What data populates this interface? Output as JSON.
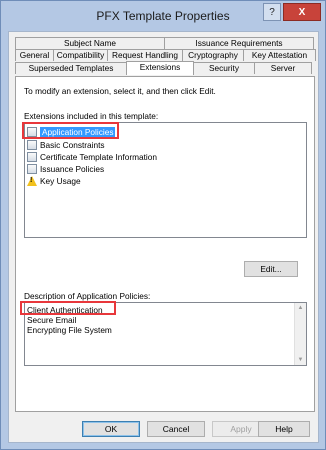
{
  "window": {
    "title": "PFX Template Properties",
    "help_button": "?",
    "close_button": "X"
  },
  "tabs": {
    "row1": [
      "Subject Name",
      "Issuance Requirements"
    ],
    "row2": [
      "General",
      "Compatibility",
      "Request Handling",
      "Cryptography",
      "Key Attestation"
    ],
    "row3": [
      "Superseded Templates",
      "Extensions",
      "Security",
      "Server"
    ],
    "active": "Extensions"
  },
  "extensions": {
    "instruction": "To modify an extension, select it, and then click Edit.",
    "list_label": "Extensions included in this template:",
    "items": [
      {
        "label": "Application Policies",
        "icon": "extension-icon",
        "selected": true
      },
      {
        "label": "Basic Constraints",
        "icon": "extension-icon",
        "selected": false
      },
      {
        "label": "Certificate Template Information",
        "icon": "extension-icon",
        "selected": false
      },
      {
        "label": "Issuance Policies",
        "icon": "extension-icon",
        "selected": false
      },
      {
        "label": "Key Usage",
        "icon": "warning-icon",
        "selected": false
      }
    ],
    "edit_button": "Edit...",
    "description_label": "Description of Application Policies:",
    "description_lines": [
      "Client Authentication",
      "Secure Email",
      "Encrypting File System"
    ]
  },
  "buttons": {
    "ok": "OK",
    "cancel": "Cancel",
    "apply": "Apply",
    "help": "Help"
  },
  "colors": {
    "selection": "#3399ff",
    "highlight_box": "#e8373b",
    "close_button": "#c8433a",
    "title_bar": "#b4c8e4"
  }
}
